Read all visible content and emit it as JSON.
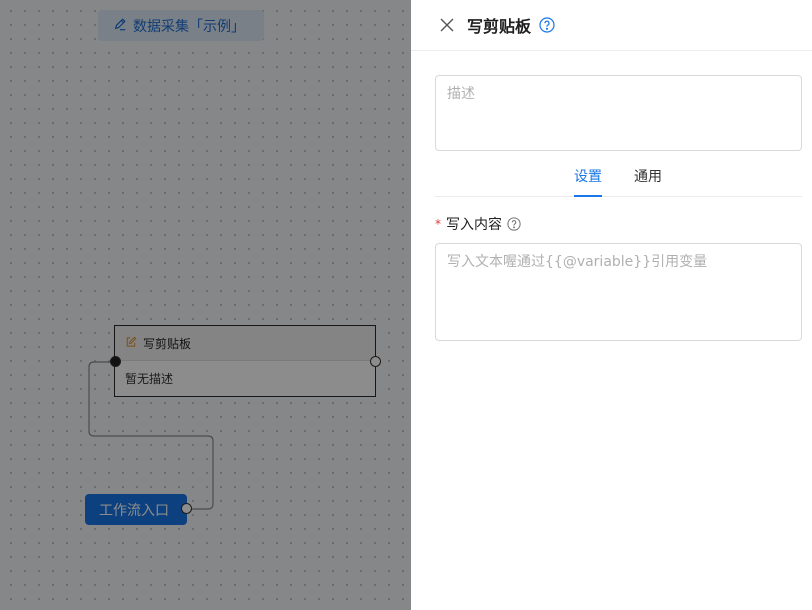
{
  "canvas": {
    "title_chip": "数据采集「示例」",
    "node": {
      "title": "写剪贴板",
      "description": "暂无描述"
    },
    "entry_node": "工作流入口"
  },
  "drawer": {
    "title": "写剪贴板",
    "description_placeholder": "描述",
    "tabs": [
      {
        "label": "设置",
        "active": true
      },
      {
        "label": "通用",
        "active": false
      }
    ],
    "field": {
      "label": "写入内容",
      "required_mark": "*",
      "placeholder": "写入文本喔通过{{@variable}}引用变量"
    }
  },
  "colors": {
    "accent": "#1976e6",
    "required": "#e23c3c"
  },
  "icons": [
    "edit-icon",
    "clipboard-edit-icon",
    "close-icon",
    "help-circle-icon"
  ]
}
